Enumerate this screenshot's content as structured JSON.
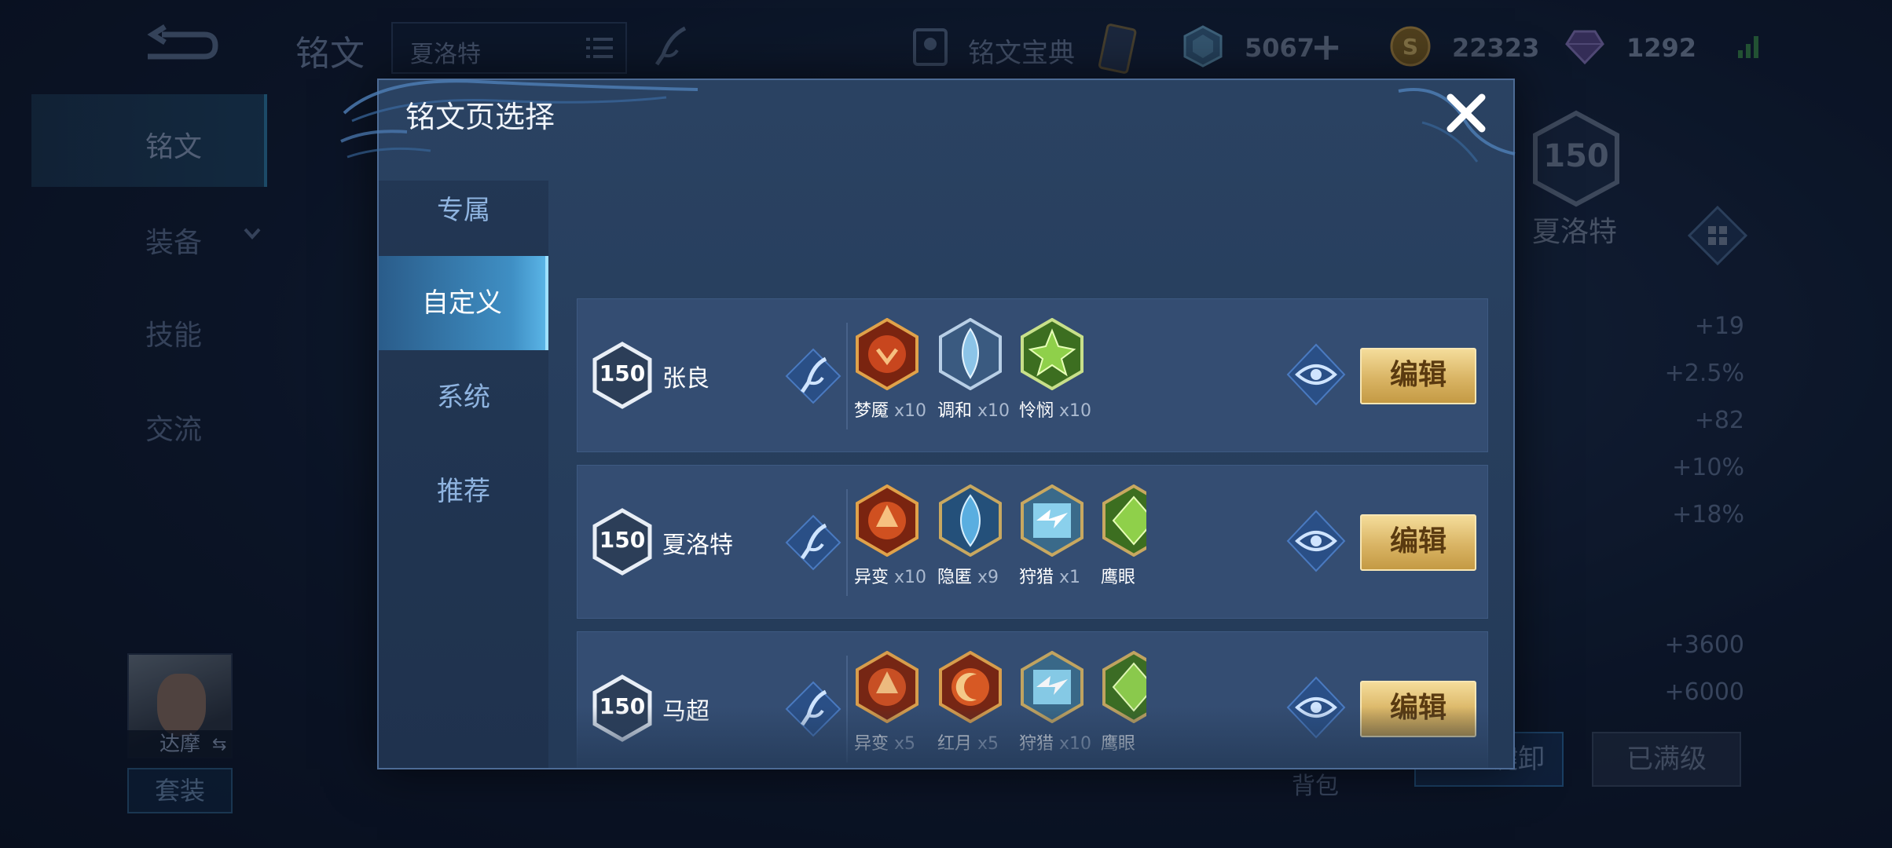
{
  "top": {
    "title": "铭文",
    "page_select": "夏洛特",
    "codex": "铭文宝典",
    "currency": [
      {
        "icon": "crystal-icon",
        "value": "5067"
      },
      {
        "icon": "gold-coin-icon",
        "value": "22323"
      },
      {
        "icon": "gem-icon",
        "value": "1292"
      }
    ]
  },
  "left_nav": [
    {
      "label": "铭文"
    },
    {
      "label": "装备"
    },
    {
      "label": "技能"
    },
    {
      "label": "交流"
    }
  ],
  "hero": {
    "name": "达摩",
    "suit_button": "套装"
  },
  "right": {
    "level": "150",
    "hero_name": "夏洛特",
    "stats": [
      "+19",
      "+2.5%",
      "+82",
      "+10%",
      "+18%",
      "+3600",
      "+6000"
    ],
    "bag_label": "背包",
    "unload_button": "一键卸",
    "maxed_button": "已满级"
  },
  "modal": {
    "title": "铭文页选择",
    "tabs": [
      {
        "label": "专属"
      },
      {
        "label": "自定义"
      },
      {
        "label": "系统"
      },
      {
        "label": "推荐"
      }
    ],
    "pages": [
      {
        "level": "150",
        "hero": "张良",
        "edit": "编辑",
        "runes": [
          {
            "name": "梦魇",
            "count": "x10",
            "color": "#c8461e"
          },
          {
            "name": "调和",
            "count": "x10",
            "color": "#7aa6c8"
          },
          {
            "name": "怜悯",
            "count": "x10",
            "color": "#6cae36"
          }
        ]
      },
      {
        "level": "150",
        "hero": "夏洛特",
        "edit": "编辑",
        "runes": [
          {
            "name": "异变",
            "count": "x10",
            "color": "#c8461e"
          },
          {
            "name": "隐匿",
            "count": "x9",
            "color": "#4a9ad0"
          },
          {
            "name": "狩猎",
            "count": "x1",
            "color": "#6ab8d8"
          },
          {
            "name": "鹰眼",
            "count": "",
            "color": "#6cae36"
          }
        ]
      },
      {
        "level": "150",
        "hero": "马超",
        "edit": "编辑",
        "runes": [
          {
            "name": "异变",
            "count": "x5",
            "color": "#c8461e"
          },
          {
            "name": "红月",
            "count": "x5",
            "color": "#d24a1c"
          },
          {
            "name": "狩猎",
            "count": "x10",
            "color": "#6ab8d8"
          },
          {
            "name": "鹰眼",
            "count": "",
            "color": "#6cae36"
          }
        ]
      }
    ]
  }
}
